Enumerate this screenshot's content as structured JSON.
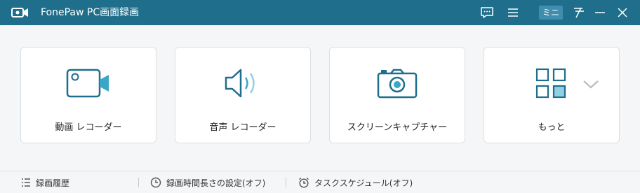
{
  "window": {
    "title": "FonePaw PC画面録画",
    "logo_icon": "camera-logo-icon",
    "mini_label": "ミニ",
    "titlebar_color": "#1f6e8c",
    "accent_color": "#1f6e8c"
  },
  "titlebar_buttons": [
    {
      "name": "feedback-icon"
    },
    {
      "name": "menu-icon"
    },
    {
      "name": "mini-mode-button"
    },
    {
      "name": "pin-icon"
    },
    {
      "name": "minimize-icon"
    },
    {
      "name": "close-icon"
    }
  ],
  "cards": [
    {
      "label": "動画 レコーダー",
      "icon": "video-camera-icon"
    },
    {
      "label": "音声 レコーダー",
      "icon": "speaker-icon"
    },
    {
      "label": "スクリーンキャプチャー",
      "icon": "camera-icon"
    },
    {
      "label": "もっと",
      "icon": "grid-icon",
      "extra_icon": "chevron-down-icon"
    }
  ],
  "bottom_bar": [
    {
      "label": "録画履歴",
      "icon": "list-icon"
    },
    {
      "label": "録画時間長さの設定(オフ)",
      "icon": "clock-icon"
    },
    {
      "label": "タスクスケジュール(オフ)",
      "icon": "alarm-clock-icon"
    }
  ]
}
